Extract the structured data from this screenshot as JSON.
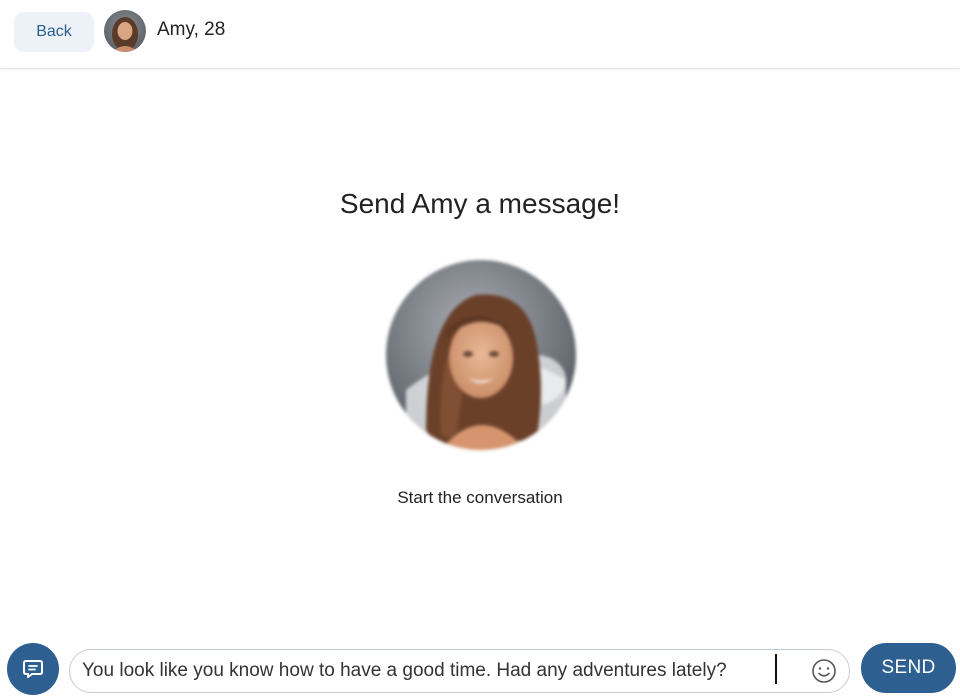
{
  "header": {
    "back_label": "Back",
    "name_age": "Amy, 28"
  },
  "main": {
    "prompt": "Send Amy a message!",
    "start_text": "Start the conversation"
  },
  "composer": {
    "message_value": "You look like you know how to have a good time. Had any adventures lately?",
    "send_label": "SEND",
    "chat_icon": "chat-bubble-icon",
    "emoji_icon": "smiley-icon"
  },
  "colors": {
    "accent": "#2d5f91",
    "back_bg": "#edf2f8",
    "back_text": "#2c5f8d"
  }
}
